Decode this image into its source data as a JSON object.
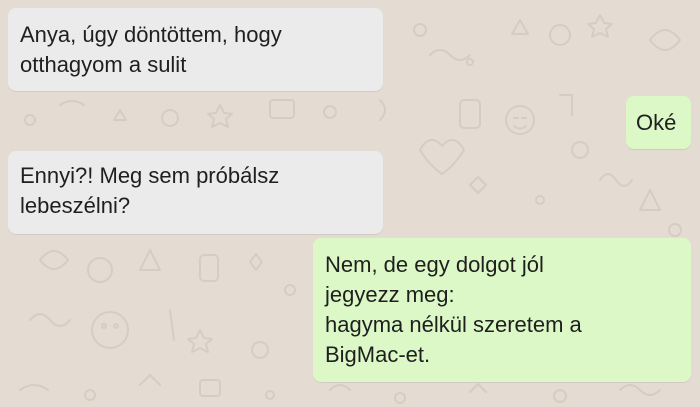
{
  "chat": {
    "background_color": "#e4dcd3",
    "incoming_color": "#ebebeb",
    "outgoing_color": "#dcf8c6",
    "messages": [
      {
        "direction": "incoming",
        "text": "Anya, úgy döntöttem, hogy\notthagyom a sulit"
      },
      {
        "direction": "outgoing",
        "text": "Oké"
      },
      {
        "direction": "incoming",
        "text": "Ennyi?! Meg sem próbálsz\nlebeszélni?"
      },
      {
        "direction": "outgoing",
        "text": "Nem, de egy dolgot jól\njegyezz meg:\nhagyma nélkül szeretem a\nBigMac-et."
      }
    ]
  }
}
